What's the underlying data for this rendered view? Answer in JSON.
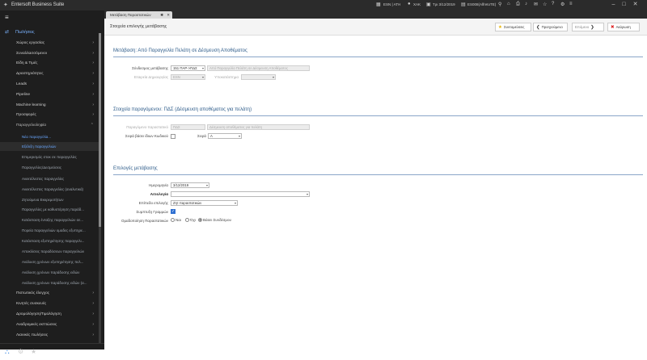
{
  "app": {
    "title": "Entersoft Business Suite",
    "company": "ESN | ATH",
    "user": "XAK",
    "date": "Τρι 3/12/2019",
    "db": "ES008(AlfretoTE)"
  },
  "tab": {
    "label": "Μετάβαση Παραστατικών"
  },
  "page": {
    "title": "Στοιχεία επιλογής μετάβασης"
  },
  "toolbar": {
    "favorites": "Συντομεύσεις",
    "previous": "Προηγούμενο",
    "next": "Επόμενο",
    "cancel": "Ακύρωση"
  },
  "sidebar": {
    "items": [
      {
        "label": "Πωλήσεις",
        "type": "main"
      },
      {
        "label": "Χώρος εργασίας",
        "type": "menu"
      },
      {
        "label": "Συναλλασσόμενοι",
        "type": "menu"
      },
      {
        "label": "Είδη & Τιμές",
        "type": "menu"
      },
      {
        "label": "Δραστηριότητες",
        "type": "menu"
      },
      {
        "label": "Leads",
        "type": "menu"
      },
      {
        "label": "Pipeline",
        "type": "menu"
      },
      {
        "label": "Machine learning",
        "type": "menu"
      },
      {
        "label": "Προσφορές",
        "type": "menu"
      },
      {
        "label": "Παραγγελιοληψία",
        "type": "submenu"
      },
      {
        "label": "Νέα παραγγελία...",
        "type": "current"
      },
      {
        "label": "Εξέλιξη παραγγελιών",
        "type": "selected"
      },
      {
        "label": "Επιμερισμός στοκ σε παραγγελίες",
        "type": "sub"
      },
      {
        "label": "Παραγγελίες/Δεσμεύσεις",
        "type": "sub"
      },
      {
        "label": "Ανεκτέλεστες παραγγελίες",
        "type": "sub"
      },
      {
        "label": "Ανεκτέλεστες παραγγελίες (αναλυτικά)",
        "type": "sub"
      },
      {
        "label": "Ζητούμενα Εκκρεμοτήτων",
        "type": "sub"
      },
      {
        "label": "Παραγγελίες με καθυστέρηση παράδ...",
        "type": "sub"
      },
      {
        "label": "Κατάσταση ένταξης παραγγελιών σε...",
        "type": "sub"
      },
      {
        "label": "Πορεία παραγγελιών ομαδες εξυπηρε...",
        "type": "sub"
      },
      {
        "label": "Κατάσταση εξυπηρέτησης παραγγελι...",
        "type": "sub"
      },
      {
        "label": "Αποκλίσεις παραδόσεων παραγγελιών",
        "type": "sub"
      },
      {
        "label": "Ανάλυση χρόνων εξυπηρέτησης πελ...",
        "type": "sub"
      },
      {
        "label": "Ανάλυση χρόνων παράδοσης ειδών",
        "type": "sub"
      },
      {
        "label": "Ανάλυση χρόνων παράδοσης ειδών (α...",
        "type": "sub"
      },
      {
        "label": "Πιστωτικός έλεγχος",
        "type": "menu"
      },
      {
        "label": "Κινητές συσκευές",
        "type": "menu"
      },
      {
        "label": "Δρομολόγηση/Τιμολόγηση",
        "type": "menu"
      },
      {
        "label": "Αναδρομικές εκπτώσεις",
        "type": "menu"
      },
      {
        "label": "Λιανικές πωλήσεις",
        "type": "menu"
      }
    ]
  },
  "section1": {
    "title": "Μετάβαση: Από Παραγγελία Πελάτη σε Δέσμευση Αποθέματος",
    "link_label": "Σύνδεσμος μετάβασης",
    "link_value": "151 ΠΑΡ->ΠΔΣ",
    "link_desc": "Από Παραγγελία Πελάτη σε Δέσμευση Αποθέματος",
    "company_label": "Εταιρεία Δημιουργίας",
    "company_value": "ESN",
    "branch_label": "Υποκατάστημα"
  },
  "section2": {
    "title": "Στοιχεία παραγόμενου: ΠΔΣ (Δέσμευση αποθέματος για πελάτη)",
    "doc_label": "Παραγόμενο παραστατικό",
    "doc_code": "ΠΔΣ",
    "doc_desc": "Δέσμευση αποθέματος για πελάτη",
    "series_label": "Σειρά βάσει ίδιων Κωδικού",
    "series2_label": "Σειρά",
    "series_value": "Α"
  },
  "section3": {
    "title": "Επιλογές μετάβασης",
    "date_label": "Ημερομηνία",
    "date_value": "3/12/2019",
    "reason_label": "Αιτιολογία",
    "option_label": "Επίπεδο επιλογής",
    "option_value": "Ζητ παραστατικών",
    "grouping_label": "Συμπτυξη Γραμμών",
    "grouping_docs_label": "Ομαδοποίηση Παραστατικών",
    "radio_yes": "Ναι",
    "radio_no": "Όχι",
    "radio_rules": "Βάσει Συνδέσμου"
  }
}
